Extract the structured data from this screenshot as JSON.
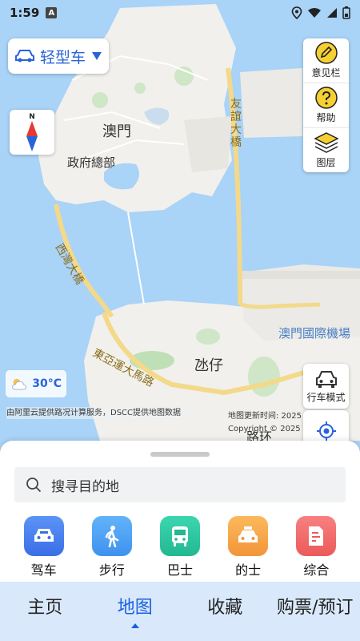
{
  "status": {
    "time": "1:59",
    "app_badge": "A"
  },
  "vehicle": {
    "label": "轻型车"
  },
  "compass": {
    "north": "N"
  },
  "tools": [
    {
      "label": "意见栏",
      "icon": "edit-icon"
    },
    {
      "label": "帮助",
      "icon": "help-icon"
    },
    {
      "label": "图层",
      "icon": "layers-icon"
    }
  ],
  "map_labels": {
    "macau": "澳門",
    "gov_hq": "政府總部",
    "friendship_bridge": "友誼大橋",
    "sai_van_bridge": "西灣大橋",
    "east_asia_road": "東亞運大馬路",
    "airport": "澳門國際機場",
    "taipa": "氹仔",
    "coloane_partial": "路环"
  },
  "weather": {
    "temp": "30°C"
  },
  "attribution": {
    "left": "由阿里云提供路况计算服务，DSCC提供地图数据",
    "right_line1": "地图更新时间: 2025",
    "right_line2": "Copyright © 2025"
  },
  "drive_mode": {
    "label": "行车模式"
  },
  "search": {
    "placeholder": "搜寻目的地"
  },
  "modes": [
    {
      "label": "驾车",
      "icon": "car-icon",
      "color": "#4a7ff0"
    },
    {
      "label": "步行",
      "icon": "walk-icon",
      "color": "#4a9ff5"
    },
    {
      "label": "巴士",
      "icon": "bus-icon",
      "color": "#2fc7a0"
    },
    {
      "label": "的士",
      "icon": "taxi-icon",
      "color": "#f7a64a"
    },
    {
      "label": "综合",
      "icon": "document-icon",
      "color": "#f06a6a"
    }
  ],
  "nav": [
    {
      "label": "主页"
    },
    {
      "label": "地图"
    },
    {
      "label": "收藏"
    },
    {
      "label": "购票/预订"
    }
  ],
  "colors": {
    "accent": "#1a5fe0",
    "sea": "#a9d3f7",
    "land": "#f1f0ec",
    "road": "#f3d98a"
  }
}
